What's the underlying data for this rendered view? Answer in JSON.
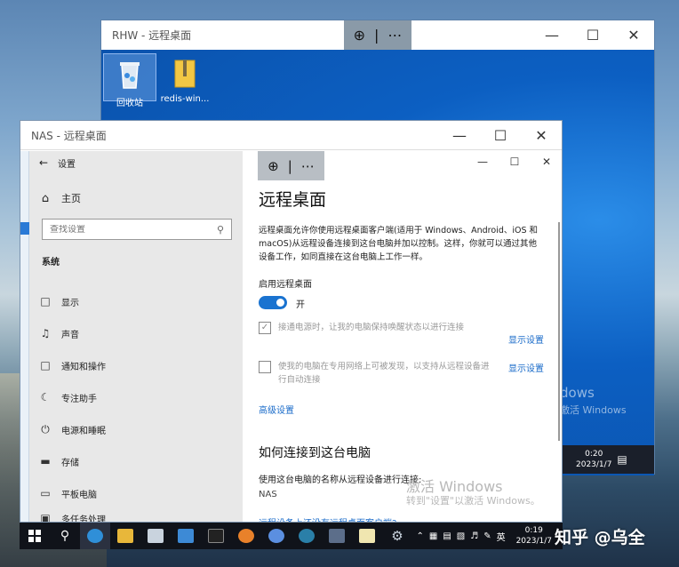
{
  "rhw_window": {
    "title": "RHW - 远程桌面",
    "desktop_icons": [
      {
        "label": "回收站"
      },
      {
        "label": "redis-win..."
      }
    ],
    "activate_title": "dows",
    "activate_sub": "激活 Windows",
    "clock_time": "0:20",
    "clock_date": "2023/1/7"
  },
  "nas_window": {
    "title": "NAS - 远程桌面"
  },
  "settings": {
    "header": "设置",
    "home": "主页",
    "search_placeholder": "查找设置",
    "section": "系统",
    "nav_items": [
      {
        "label": "显示"
      },
      {
        "label": "声音"
      },
      {
        "label": "通知和操作"
      },
      {
        "label": "专注助手"
      },
      {
        "label": "电源和睡眠"
      },
      {
        "label": "存储"
      },
      {
        "label": "平板电脑"
      },
      {
        "label": "多任务处理"
      }
    ],
    "page_title": "远程桌面",
    "description": "远程桌面允许你使用远程桌面客户端(适用于 Windows、Android、iOS 和 macOS)从远程设备连接到这台电脑并加以控制。这样，你就可以通过其他设备工作，如同直接在这台电脑上工作一样。",
    "enable_label": "启用远程桌面",
    "toggle_state": "开",
    "option1": "接通电源时，让我的电脑保持唤醒状态以进行连接",
    "option1_link": "显示设置",
    "option2": "使我的电脑在专用网络上可被发现，以支持从远程设备进行自动连接",
    "option2_link": "显示设置",
    "advanced_link": "高级设置",
    "how_to_title": "如何连接到这台电脑",
    "how_to_text": "使用这台电脑的名称从远程设备进行连接:",
    "pc_name": "NAS",
    "bottom_link": "远程设备上还没有远程桌面客户端?",
    "activate_title": "激活 Windows",
    "activate_sub": "转到\"设置\"以激活 Windows。"
  },
  "taskbar": {
    "ime": "英",
    "clock_time": "0:19",
    "clock_date": "2023/1/7"
  },
  "watermark": "知乎 @乌全"
}
